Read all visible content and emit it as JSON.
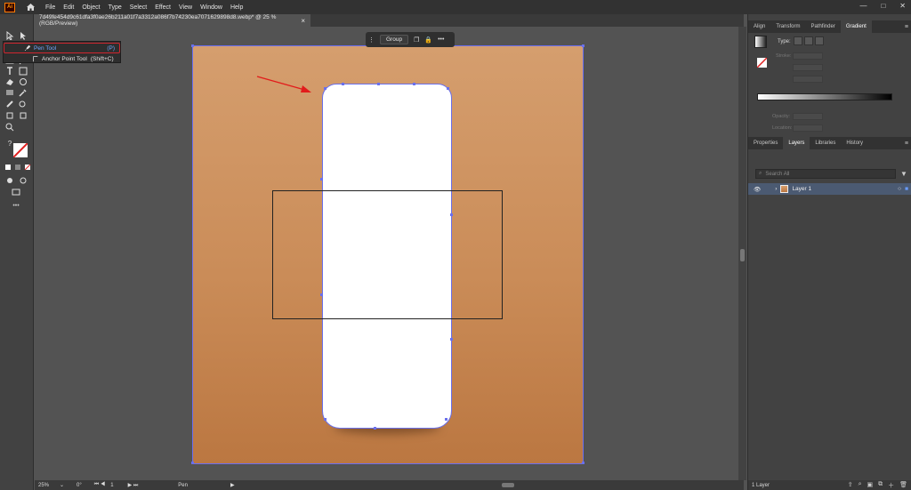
{
  "app": {
    "logo_text": "Ai"
  },
  "menu": [
    "File",
    "Edit",
    "Object",
    "Type",
    "Select",
    "Effect",
    "View",
    "Window",
    "Help"
  ],
  "window_controls": {
    "minimize": "—",
    "maximize": "□",
    "close": "✕"
  },
  "document_tab": {
    "title": "7d49fe454d9c61dfa3f0ae26b211a01f7a3312a086f7b74230ea7071629898d8.webp* @ 25 % (RGB/Preview)",
    "close": "×"
  },
  "flyout": {
    "pen_label": "Pen Tool",
    "pen_shortcut": "(P)",
    "anchor_label": "Anchor Point Tool",
    "anchor_shortcut": "(Shift+C)"
  },
  "context_bar": {
    "group_label": "Group",
    "more": "•••"
  },
  "status": {
    "zoom": "25%",
    "angle": "0°",
    "artboard": "1",
    "tool": "Pen"
  },
  "tools_misc": {
    "more": "•••",
    "question": "?"
  },
  "top_panel": {
    "tabs": [
      "Align",
      "Transform",
      "Pathfinder",
      "Gradient"
    ],
    "active_tab": "Gradient",
    "type_label": "Type:",
    "stroke_label": "Stroke:",
    "opacity_label": "Opacity:",
    "location_label": "Location:"
  },
  "layers_panel": {
    "tabs": [
      "Properties",
      "Layers",
      "Libraries",
      "History"
    ],
    "active_tab": "Layers",
    "search_placeholder": "Search All",
    "layer_name": "Layer 1",
    "footer_count": "1 Layer"
  },
  "colors": {
    "artboard_top": "#d59e6e",
    "artboard_bottom": "#bb7741",
    "selection": "#6a70ec",
    "highlight": "#d0262f"
  }
}
